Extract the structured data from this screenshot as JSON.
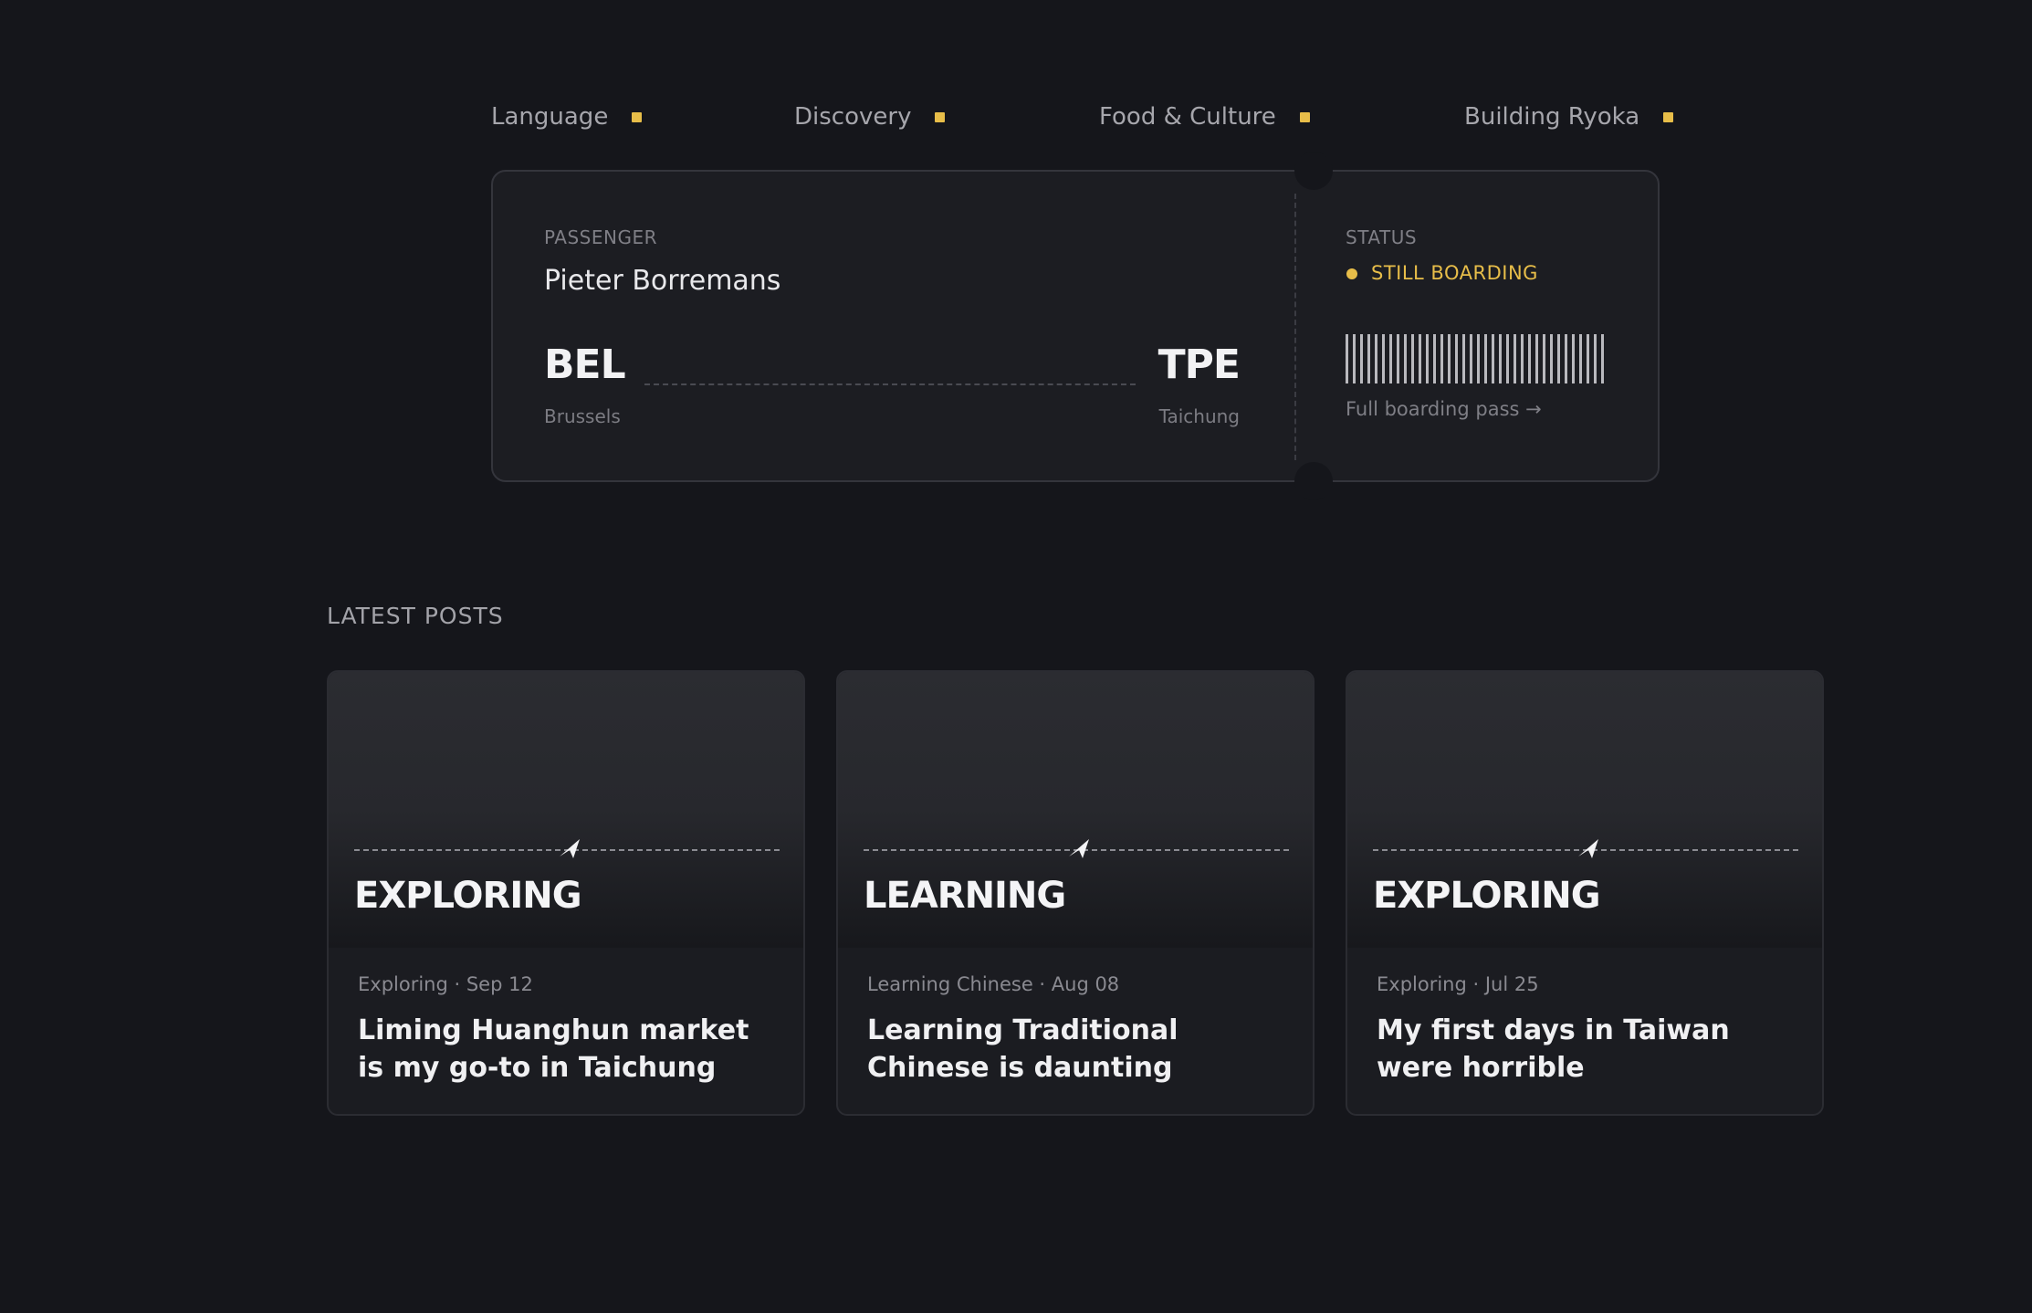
{
  "nav": {
    "items": [
      {
        "label": "Language"
      },
      {
        "label": "Discovery"
      },
      {
        "label": "Food & Culture"
      },
      {
        "label": "Building Ryoka"
      }
    ],
    "accent_color": "#e7bd49"
  },
  "boarding_pass": {
    "passenger_label": "PASSENGER",
    "passenger_name": "Pieter Borremans",
    "origin": {
      "code": "BEL",
      "city": "Brussels"
    },
    "destination": {
      "code": "TPE",
      "city": "Taichung"
    },
    "status_label": "STATUS",
    "status_value": "STILL BOARDING",
    "status_color": "#e7bd49",
    "link_label": "Full boarding pass →"
  },
  "latest_posts": {
    "heading": "LATEST POSTS",
    "posts": [
      {
        "cover_category": "EXPLORING",
        "meta": "Exploring · Sep 12",
        "title": "Liming Huanghun market is my go-to in Taichung"
      },
      {
        "cover_category": "LEARNING",
        "meta": "Learning Chinese · Aug 08",
        "title": "Learning Traditional Chinese is daunting"
      },
      {
        "cover_category": "EXPLORING",
        "meta": "Exploring · Jul 25",
        "title": "My first days in Taiwan were horrible"
      }
    ]
  }
}
